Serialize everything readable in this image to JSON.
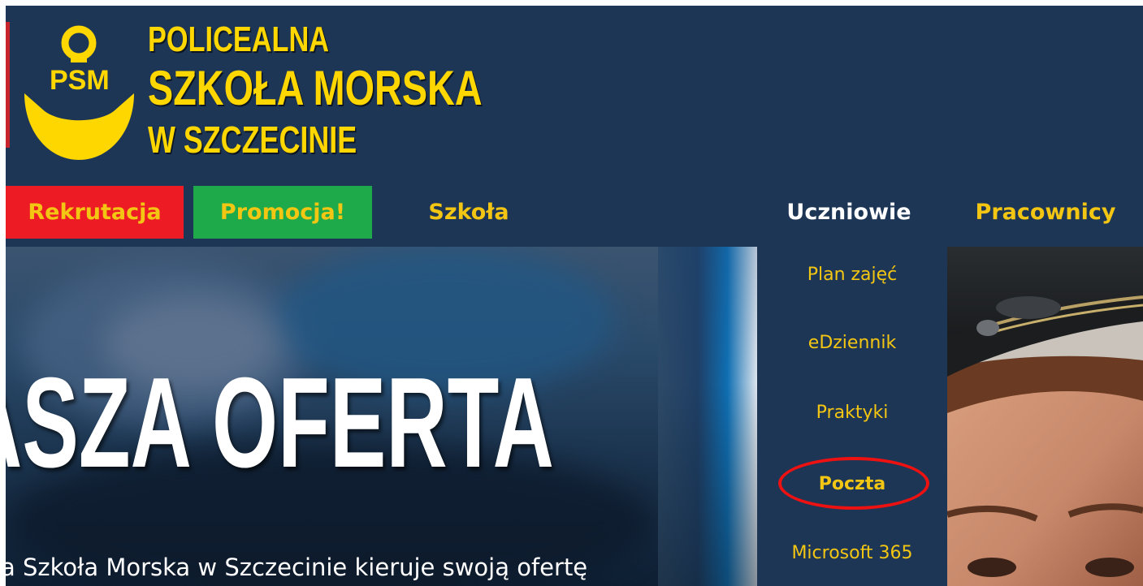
{
  "header": {
    "logo": {
      "badge": "PSM",
      "line1": "POLICEALNA",
      "line2": "SZKOŁA MORSKA",
      "line3": "W SZCZECINIE"
    }
  },
  "nav": {
    "items": [
      {
        "label": "Rekrutacja",
        "bg": "#ed1c24"
      },
      {
        "label": "Promocja!",
        "bg": "#1eaa4a"
      },
      {
        "label": "Szkoła"
      },
      {
        "label": "Uczniowie",
        "active": true
      },
      {
        "label": "Pracownicy"
      }
    ]
  },
  "dropdown": {
    "items": [
      {
        "label": "Plan zajęć"
      },
      {
        "label": "eDziennik"
      },
      {
        "label": "Praktyki"
      },
      {
        "label": "Poczta",
        "highlighted": true
      },
      {
        "label": "Microsoft 365"
      }
    ],
    "highlight_color": "#ee1111"
  },
  "hero": {
    "title": "ASZA OFERTA",
    "subtitle": "a Szkoła Morska w Szczecinie kieruje swoją ofertę"
  },
  "colors": {
    "background": "#1e3655",
    "accent_yellow": "#f3c613",
    "logo_yellow": "#ffd700"
  }
}
